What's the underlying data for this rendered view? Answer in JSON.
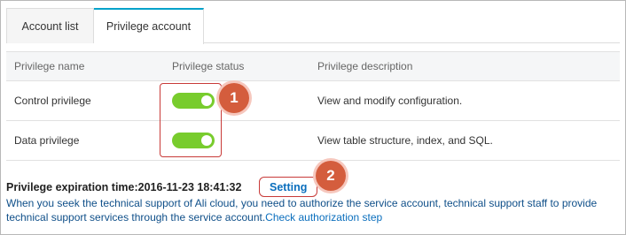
{
  "tabs": [
    {
      "label": "Account list"
    },
    {
      "label": "Privilege account"
    }
  ],
  "table": {
    "headers": [
      "Privilege name",
      "Privilege status",
      "Privilege description"
    ],
    "rows": [
      {
        "name": "Control privilege",
        "status": "on",
        "description": "View and modify configuration."
      },
      {
        "name": "Data privilege",
        "status": "on",
        "description": "View table structure, index, and SQL."
      }
    ]
  },
  "callouts": [
    "1",
    "2"
  ],
  "expiration": {
    "text": "Privilege expiration time:2016-11-23 18:41:32",
    "setting_label": "Setting"
  },
  "notice": {
    "text": "When you seek the technical support of Ali cloud, you need to authorize the service account, technical support staff to provide technical support services through the service account.",
    "link_label": "Check authorization step"
  },
  "colors": {
    "toggle_on": "#78cc2d",
    "callout": "#d45d3d",
    "annotation_border": "#c83a38",
    "link": "#0a6ebd",
    "active_tab_accent": "#00a2ca"
  }
}
